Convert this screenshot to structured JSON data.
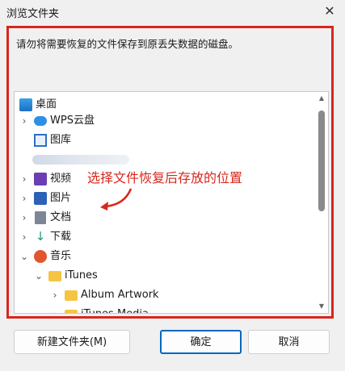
{
  "window": {
    "title": "浏览文件夹"
  },
  "dialog": {
    "instruction": "请勿将需要恢复的文件保存到原丢失数据的磁盘。"
  },
  "tree": {
    "items": [
      {
        "label": "桌面",
        "icon": "desktop-icon",
        "chevron": ""
      },
      {
        "label": "WPS云盘",
        "icon": "cloud-icon",
        "chevron": "›"
      },
      {
        "label": "图库",
        "icon": "gallery-icon",
        "chevron": ""
      },
      {
        "label": "",
        "icon": "user-icon",
        "chevron": ""
      },
      {
        "label": "视频",
        "icon": "video-icon",
        "chevron": "›"
      },
      {
        "label": "图片",
        "icon": "pictures-icon",
        "chevron": "›"
      },
      {
        "label": "文档",
        "icon": "documents-icon",
        "chevron": "›"
      },
      {
        "label": "下载",
        "icon": "download-icon",
        "chevron": "›"
      },
      {
        "label": "音乐",
        "icon": "music-icon",
        "chevron": "⌄"
      },
      {
        "label": "iTunes",
        "icon": "folder-icon",
        "chevron": "⌄"
      },
      {
        "label": "Album Artwork",
        "icon": "folder-icon",
        "chevron": "›"
      },
      {
        "label": "iTunes Media",
        "icon": "folder-icon",
        "chevron": "›"
      }
    ]
  },
  "annotation": {
    "text": "选择文件恢复后存放的位置"
  },
  "buttons": {
    "new_folder": "新建文件夹(M)",
    "ok": "确定",
    "cancel": "取消"
  },
  "colors": {
    "highlight": "#d9261c",
    "accent": "#0067c0",
    "folder": "#f5c542"
  }
}
